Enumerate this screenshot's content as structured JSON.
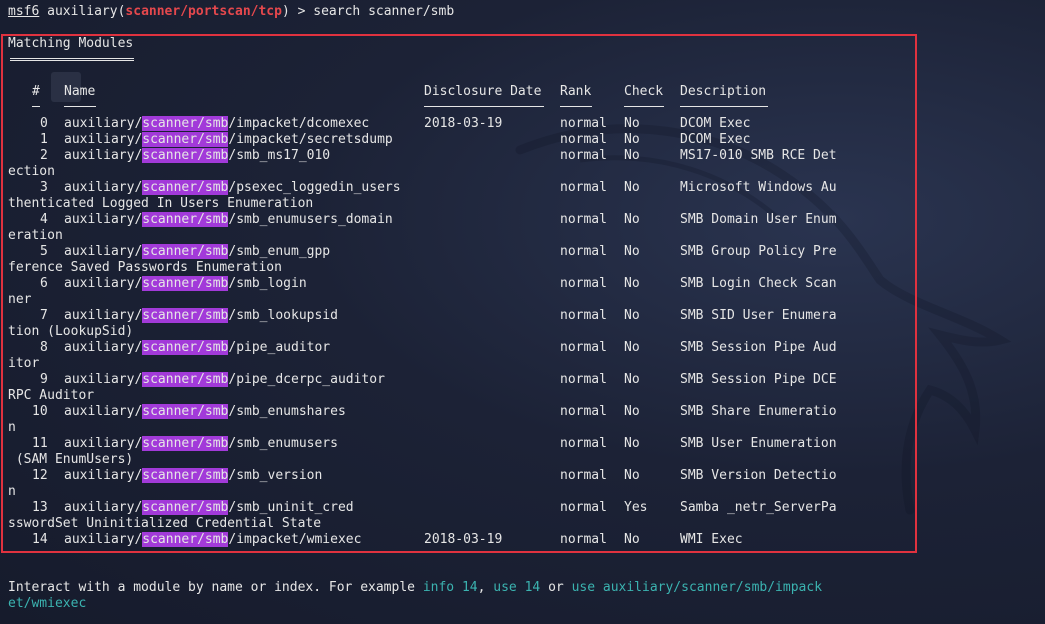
{
  "prompt": {
    "console": "msf6",
    "module_type": "auxiliary",
    "module_path": "scanner/portscan/tcp",
    "command": "search scanner/smb"
  },
  "section_title": "Matching Modules",
  "headers": {
    "num": "#",
    "name": "Name",
    "date": "Disclosure Date",
    "rank": "Rank",
    "check": "Check",
    "desc": "Description"
  },
  "prefix": "auxiliary/",
  "highlight": "scanner/smb",
  "rows": [
    {
      "num": "0",
      "suffix": "/impacket/dcomexec",
      "date": "2018-03-19",
      "rank": "normal",
      "check": "No",
      "desc": "DCOM Exec",
      "wrap": ""
    },
    {
      "num": "1",
      "suffix": "/impacket/secretsdump",
      "date": "",
      "rank": "normal",
      "check": "No",
      "desc": "DCOM Exec",
      "wrap": ""
    },
    {
      "num": "2",
      "suffix": "/smb_ms17_010",
      "date": "",
      "rank": "normal",
      "check": "No",
      "desc": "MS17-010 SMB RCE Det",
      "wrap": "ection"
    },
    {
      "num": "3",
      "suffix": "/psexec_loggedin_users",
      "date": "",
      "rank": "normal",
      "check": "No",
      "desc": "Microsoft Windows Au",
      "wrap": "thenticated Logged In Users Enumeration"
    },
    {
      "num": "4",
      "suffix": "/smb_enumusers_domain",
      "date": "",
      "rank": "normal",
      "check": "No",
      "desc": "SMB Domain User Enum",
      "wrap": "eration"
    },
    {
      "num": "5",
      "suffix": "/smb_enum_gpp",
      "date": "",
      "rank": "normal",
      "check": "No",
      "desc": "SMB Group Policy Pre",
      "wrap": "ference Saved Passwords Enumeration"
    },
    {
      "num": "6",
      "suffix": "/smb_login",
      "date": "",
      "rank": "normal",
      "check": "No",
      "desc": "SMB Login Check Scan",
      "wrap": "ner"
    },
    {
      "num": "7",
      "suffix": "/smb_lookupsid",
      "date": "",
      "rank": "normal",
      "check": "No",
      "desc": "SMB SID User Enumera",
      "wrap": "tion (LookupSid)"
    },
    {
      "num": "8",
      "suffix": "/pipe_auditor",
      "date": "",
      "rank": "normal",
      "check": "No",
      "desc": "SMB Session Pipe Aud",
      "wrap": "itor"
    },
    {
      "num": "9",
      "suffix": "/pipe_dcerpc_auditor",
      "date": "",
      "rank": "normal",
      "check": "No",
      "desc": "SMB Session Pipe DCE",
      "wrap": "RPC Auditor"
    },
    {
      "num": "10",
      "suffix": "/smb_enumshares",
      "date": "",
      "rank": "normal",
      "check": "No",
      "desc": "SMB Share Enumeratio",
      "wrap": "n"
    },
    {
      "num": "11",
      "suffix": "/smb_enumusers",
      "date": "",
      "rank": "normal",
      "check": "No",
      "desc": "SMB User Enumeration",
      "wrap": " (SAM EnumUsers)"
    },
    {
      "num": "12",
      "suffix": "/smb_version",
      "date": "",
      "rank": "normal",
      "check": "No",
      "desc": "SMB Version Detectio",
      "wrap": "n"
    },
    {
      "num": "13",
      "suffix": "/smb_uninit_cred",
      "date": "",
      "rank": "normal",
      "check": "Yes",
      "desc": "Samba _netr_ServerPa",
      "wrap": "sswordSet Uninitialized Credential State"
    },
    {
      "num": "14",
      "suffix": "/impacket/wmiexec",
      "date": "2018-03-19",
      "rank": "normal",
      "check": "No",
      "desc": "WMI Exec",
      "wrap": ""
    }
  ],
  "footer": {
    "text1": "Interact with a module by name or index. For example ",
    "info": "info 14",
    "comma": ", ",
    "use14": "use 14",
    "or": " or ",
    "use_path1": "use auxiliary/scanner/smb/impack",
    "use_path2": "et/wmiexec"
  },
  "colors": {
    "highlight_bg": "#a23ad9",
    "frame": "#e0323f",
    "prompt_red": "#e5484d",
    "link_cyan": "#3bb3b0"
  }
}
